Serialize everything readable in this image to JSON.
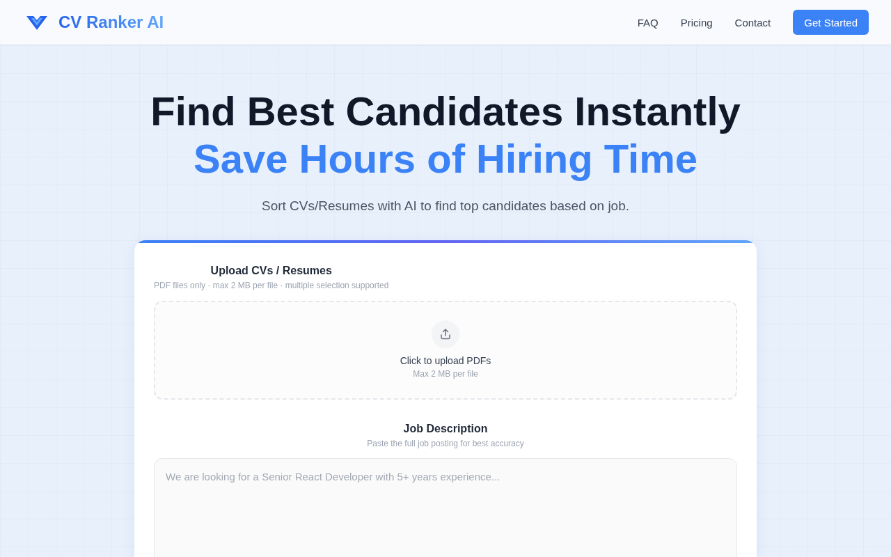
{
  "header": {
    "brand": "CV Ranker AI",
    "nav": [
      {
        "label": "FAQ"
      },
      {
        "label": "Pricing"
      },
      {
        "label": "Contact"
      }
    ],
    "cta": "Get Started"
  },
  "hero": {
    "title": "Find Best Candidates Instantly",
    "highlight": "Save Hours of Hiring Time",
    "subtitle": "Sort CVs/Resumes with AI to find top candidates based on job."
  },
  "form": {
    "sections": [
      {
        "kind": "upload",
        "label": "Upload CVs / Resumes",
        "hint": "PDF files only · max 2 MB per file · multiple selection supported",
        "dropzone": {
          "title": "Click to upload PDFs",
          "note": "Max 2 MB per file"
        }
      },
      {
        "kind": "textarea",
        "label": "Job Description",
        "hint": "Paste the full job posting for best accuracy",
        "placeholder": "We are looking for a Senior React Developer with 5+ years experience..."
      }
    ]
  }
}
